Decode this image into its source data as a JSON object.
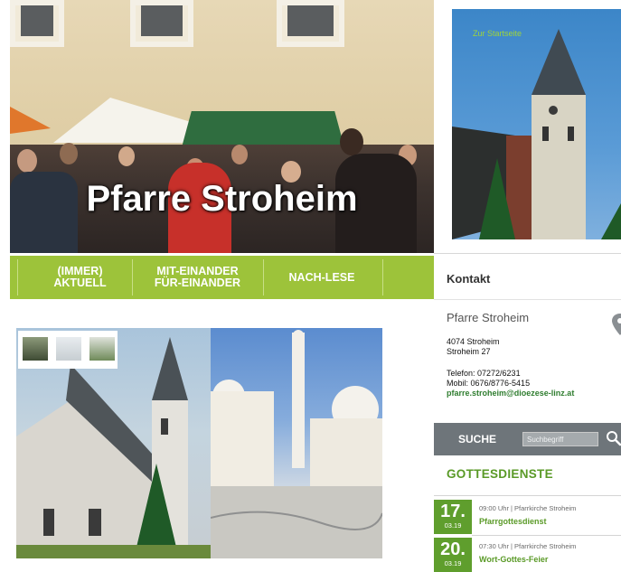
{
  "hero": {
    "title": "Pfarre Stroheim"
  },
  "church_link": {
    "label": "Zur Startseite"
  },
  "nav": {
    "items": [
      {
        "label": "(IMMER) AKTUELL"
      },
      {
        "label": "MIT-EINANDER FÜR-EINANDER"
      },
      {
        "label": "NACH-LESE"
      }
    ]
  },
  "kontakt": {
    "heading": "Kontakt",
    "name": "Pfarre Stroheim",
    "address1": "4074 Stroheim",
    "address2": "Stroheim 27",
    "phone": "Telefon: 07272/6231",
    "mobile": "Mobil: 0676/8776-5415",
    "email": "pfarre.stroheim@dioezese-linz.at"
  },
  "search": {
    "label": "SUCHE",
    "placeholder": "Suchbegriff"
  },
  "gottesdienste": {
    "heading": "GOTTESDIENSTE",
    "events": [
      {
        "day": "17.",
        "month": "03.19",
        "meta": "09:00 Uhr | Pfarrkirche Stroheim",
        "name": "Pfarrgottesdienst"
      },
      {
        "day": "20.",
        "month": "03.19",
        "meta": "07:30 Uhr | Pfarrkirche Stroheim",
        "name": "Wort-Gottes-Feier"
      }
    ]
  },
  "colors": {
    "accent_green": "#9dc33a",
    "date_green": "#5f9e2d",
    "search_gray": "#6e757a"
  }
}
